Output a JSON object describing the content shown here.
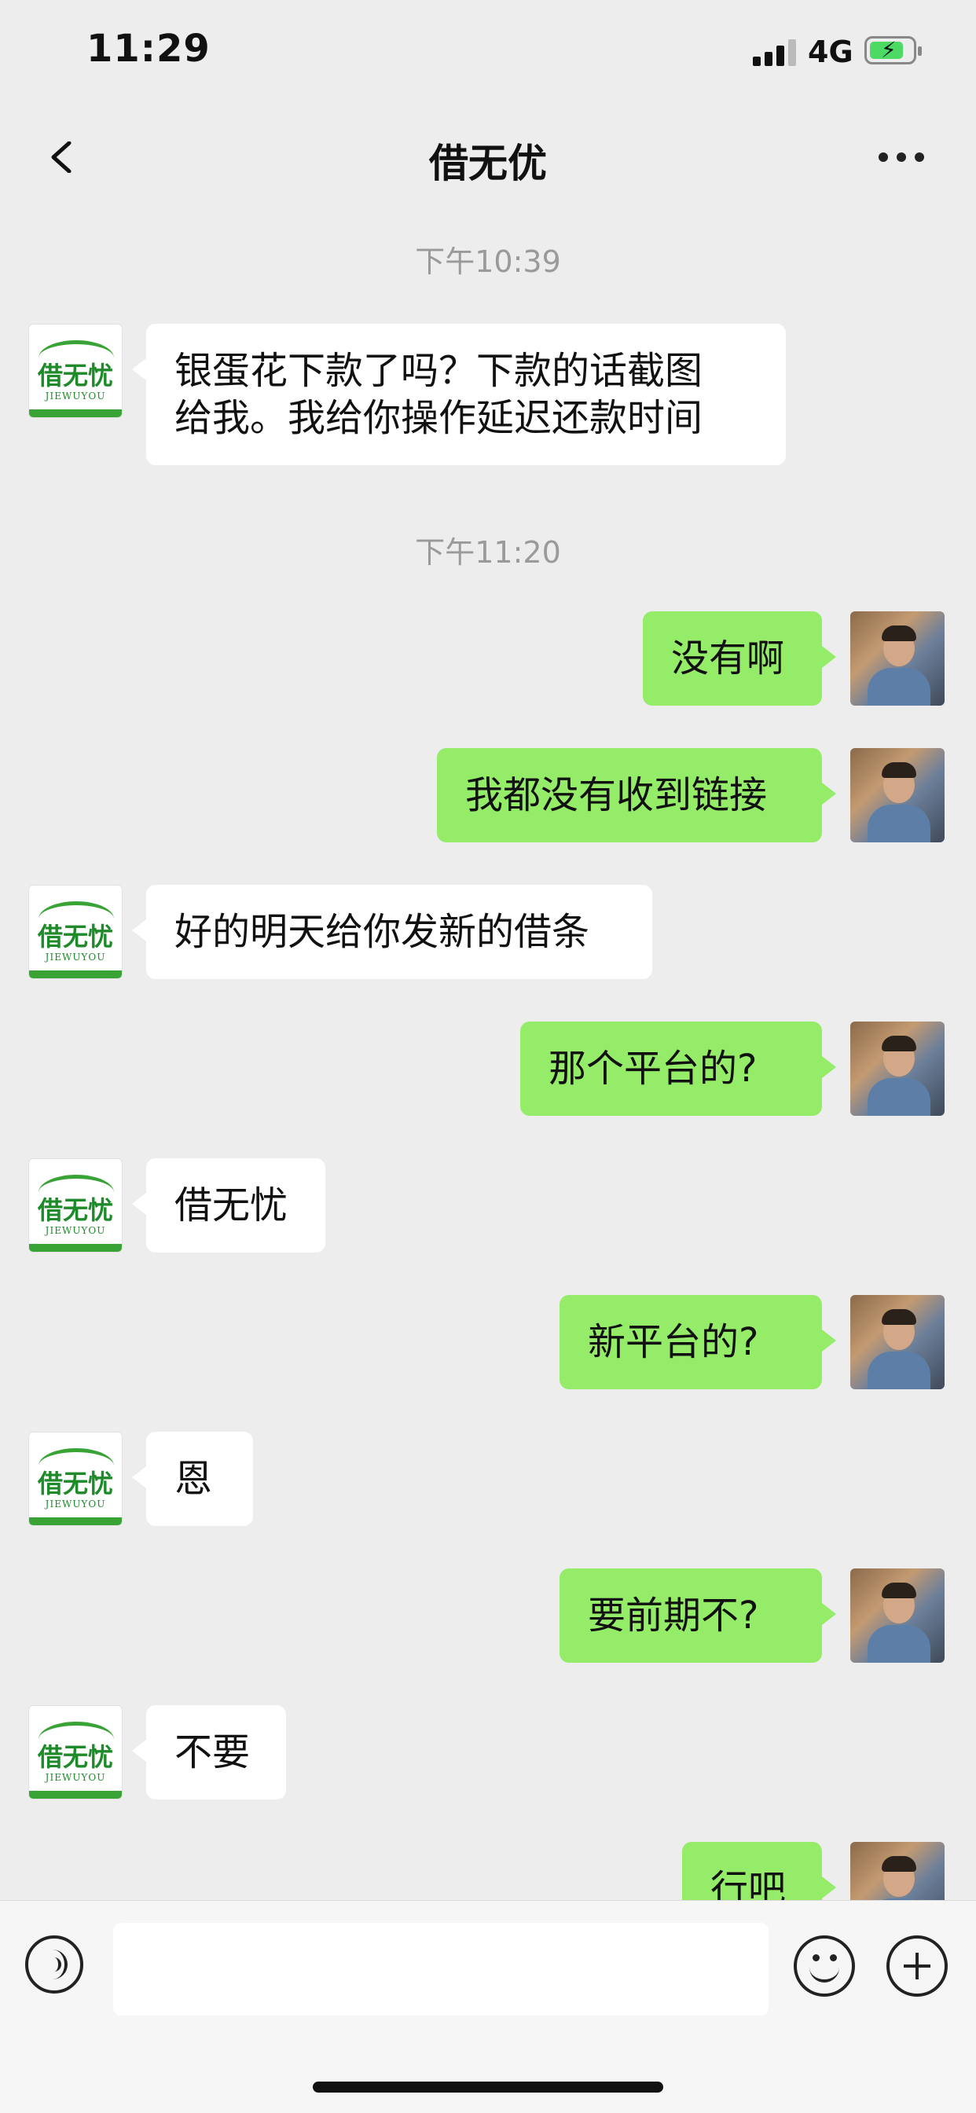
{
  "status_bar": {
    "time": "11:29",
    "network": "4G"
  },
  "nav": {
    "title": "借无优"
  },
  "contact_avatar": {
    "logo_text": "借无忧",
    "logo_subtext": "JIEWUYOU"
  },
  "colors": {
    "outgoing_bubble": "#95ec69",
    "incoming_bubble": "#ffffff",
    "background": "#ededed",
    "logo_green": "#3aa336"
  },
  "messages": [
    {
      "type": "time",
      "text": "下午10:39"
    },
    {
      "type": "in",
      "text": "银蛋花下款了吗？下款的话截图\n给我。我给你操作延迟还款时间"
    },
    {
      "type": "time",
      "text": "下午11:20"
    },
    {
      "type": "out",
      "text": "没有啊"
    },
    {
      "type": "out",
      "text": "我都没有收到链接"
    },
    {
      "type": "in",
      "text": "好的明天给你发新的借条"
    },
    {
      "type": "out",
      "text": "那个平台的?"
    },
    {
      "type": "in",
      "text": "借无忧"
    },
    {
      "type": "out",
      "text": "新平台的?"
    },
    {
      "type": "in",
      "text": "恩"
    },
    {
      "type": "out",
      "text": "要前期不?"
    },
    {
      "type": "in",
      "text": "不要"
    },
    {
      "type": "out",
      "text": "行吧"
    }
  ],
  "input": {
    "value": ""
  },
  "icons": {
    "back": "chevron-left-icon",
    "more": "more-dots-icon",
    "voice": "voice-icon",
    "emoji": "emoji-icon",
    "plus": "plus-icon"
  }
}
